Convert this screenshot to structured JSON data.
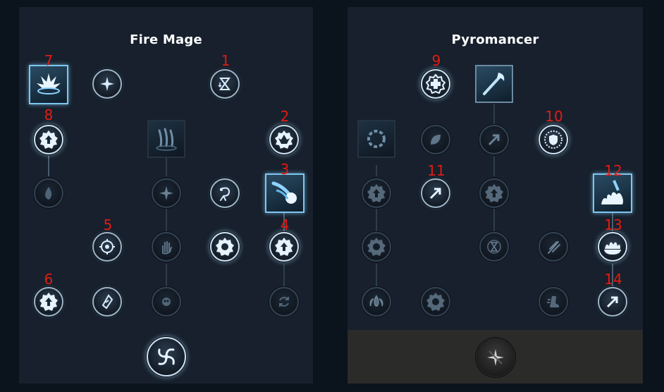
{
  "trees": [
    {
      "id": "fire-mage",
      "title": "Fire Mage"
    },
    {
      "id": "pyromancer",
      "title": "Pyromancer"
    }
  ],
  "markers": [
    "7",
    "8",
    "1",
    "2",
    "3",
    "4",
    "5",
    "6",
    "9",
    "10",
    "11",
    "12",
    "13",
    "14"
  ],
  "colors": {
    "background": "#0b131d",
    "panel": "#17202c",
    "locked_area": "#2b2b2a",
    "node_ring": "#9fb6c8",
    "node_active_glow": "#7ec6ee",
    "marker_red": "#e31b12"
  },
  "nodes": [
    {
      "tree": "fire-mage",
      "icon": "fire-burst-icon",
      "state": "active"
    },
    {
      "tree": "fire-mage",
      "icon": "sparkle-star-icon",
      "state": "available"
    },
    {
      "tree": "fire-mage",
      "icon": "hourglass-down-icon",
      "state": "available"
    },
    {
      "tree": "fire-mage",
      "icon": "badge-up-arrow-icon",
      "state": "active"
    },
    {
      "tree": "fire-mage",
      "icon": "claw-marks-icon",
      "state": "locked"
    },
    {
      "tree": "fire-mage",
      "icon": "wing-burst-icon",
      "state": "available"
    },
    {
      "tree": "fire-mage",
      "icon": "flame-icon",
      "state": "locked"
    },
    {
      "tree": "fire-mage",
      "icon": "sparkle-star-icon",
      "state": "locked"
    },
    {
      "tree": "fire-mage",
      "icon": "swirl-icon",
      "state": "available"
    },
    {
      "tree": "fire-mage",
      "icon": "meteor-icon",
      "state": "active"
    },
    {
      "tree": "fire-mage",
      "icon": "crosshair-icon",
      "state": "available"
    },
    {
      "tree": "fire-mage",
      "icon": "hand-icon",
      "state": "locked"
    },
    {
      "tree": "fire-mage",
      "icon": "gear-badge-icon",
      "state": "available"
    },
    {
      "tree": "fire-mage",
      "icon": "badge-up-arrow-icon",
      "state": "active"
    },
    {
      "tree": "fire-mage",
      "icon": "badge-up-arrow-icon",
      "state": "available"
    },
    {
      "tree": "fire-mage",
      "icon": "shard-icon",
      "state": "available"
    },
    {
      "tree": "fire-mage",
      "icon": "skull-flame-icon",
      "state": "locked"
    },
    {
      "tree": "fire-mage",
      "icon": "refresh-icon",
      "state": "locked"
    },
    {
      "tree": "fire-mage",
      "icon": "vortex-icon",
      "state": "available"
    },
    {
      "tree": "pyromancer",
      "icon": "cross-badge-icon",
      "state": "active"
    },
    {
      "tree": "pyromancer",
      "icon": "flame-staff-icon",
      "state": "available"
    },
    {
      "tree": "pyromancer",
      "icon": "fire-ring-icon",
      "state": "locked"
    },
    {
      "tree": "pyromancer",
      "icon": "leaf-icon",
      "state": "locked"
    },
    {
      "tree": "pyromancer",
      "icon": "arrow-up-right-icon",
      "state": "locked"
    },
    {
      "tree": "pyromancer",
      "icon": "shield-rays-icon",
      "state": "available"
    },
    {
      "tree": "pyromancer",
      "icon": "badge-up-arrow-icon",
      "state": "locked"
    },
    {
      "tree": "pyromancer",
      "icon": "arrow-up-right-icon",
      "state": "available"
    },
    {
      "tree": "pyromancer",
      "icon": "badge-up-arrow-icon",
      "state": "locked"
    },
    {
      "tree": "pyromancer",
      "icon": "flame-hand-icon",
      "state": "active"
    },
    {
      "tree": "pyromancer",
      "icon": "gear-badge-icon",
      "state": "locked"
    },
    {
      "tree": "pyromancer",
      "icon": "hourglass-icon",
      "state": "locked"
    },
    {
      "tree": "pyromancer",
      "icon": "claw-icon",
      "state": "locked"
    },
    {
      "tree": "pyromancer",
      "icon": "fire-bowl-icon",
      "state": "active"
    },
    {
      "tree": "pyromancer",
      "icon": "flame-wings-icon",
      "state": "locked"
    },
    {
      "tree": "pyromancer",
      "icon": "gear-badge-icon",
      "state": "locked"
    },
    {
      "tree": "pyromancer",
      "icon": "boot-icon",
      "state": "locked"
    },
    {
      "tree": "pyromancer",
      "icon": "arrow-up-right-icon",
      "state": "available"
    },
    {
      "tree": "pyromancer",
      "icon": "sparkle-star-icon",
      "state": "unavailable"
    }
  ]
}
